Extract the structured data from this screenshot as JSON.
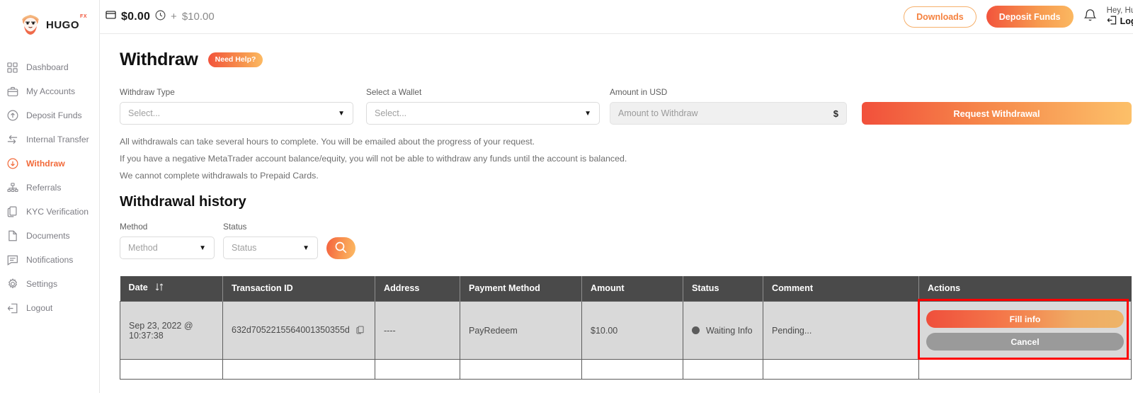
{
  "brand": {
    "name": "HUGO",
    "superscript": "FX"
  },
  "sidebar": {
    "items": [
      {
        "label": "Dashboard",
        "icon": "grid-icon",
        "active": false
      },
      {
        "label": "My Accounts",
        "icon": "briefcase-icon",
        "active": false
      },
      {
        "label": "Deposit Funds",
        "icon": "arrow-up-circle-icon",
        "active": false
      },
      {
        "label": "Internal Transfer",
        "icon": "transfer-icon",
        "active": false
      },
      {
        "label": "Withdraw",
        "icon": "arrow-down-circle-icon",
        "active": true
      },
      {
        "label": "Referrals",
        "icon": "sitemap-icon",
        "active": false
      },
      {
        "label": "KYC Verification",
        "icon": "copy-icon",
        "active": false
      },
      {
        "label": "Documents",
        "icon": "document-icon",
        "active": false
      },
      {
        "label": "Notifications",
        "icon": "message-icon",
        "active": false
      },
      {
        "label": "Settings",
        "icon": "gear-icon",
        "active": false
      },
      {
        "label": "Logout",
        "icon": "logout-icon",
        "active": false
      }
    ]
  },
  "topbar": {
    "balance": "$0.00",
    "plus": "+",
    "pending_balance": "$10.00",
    "downloads_label": "Downloads",
    "deposit_label": "Deposit Funds",
    "greeting": "Hey, Hugo's",
    "logout_label": "Logout"
  },
  "page": {
    "title": "Withdraw",
    "need_help_label": "Need Help?"
  },
  "form": {
    "withdraw_type": {
      "label": "Withdraw Type",
      "value": "Select..."
    },
    "wallet": {
      "label": "Select a Wallet",
      "value": "Select..."
    },
    "amount": {
      "label": "Amount in USD",
      "placeholder": "Amount to Withdraw",
      "value": "",
      "suffix": "$"
    },
    "submit_label": "Request Withdrawal"
  },
  "notes": [
    "All withdrawals can take several hours to complete. You will be emailed about the progress of your request.",
    "If you have a negative MetaTrader account balance/equity, you will not be able to withdraw any funds until the account is balanced.",
    "We cannot complete withdrawals to Prepaid Cards."
  ],
  "history": {
    "title": "Withdrawal history",
    "filters": {
      "method": {
        "label": "Method",
        "value": "Method"
      },
      "status": {
        "label": "Status",
        "value": "Status"
      },
      "search_icon": "search-icon"
    },
    "columns": [
      "Date",
      "Transaction ID",
      "Address",
      "Payment Method",
      "Amount",
      "Status",
      "Comment",
      "Actions"
    ],
    "sort_column": "Date",
    "rows": [
      {
        "date": "Sep 23, 2022 @ 10:37:38",
        "transaction_id": "632d7052215564001350355d",
        "address": "----",
        "payment_method": "PayRedeem",
        "amount": "$10.00",
        "status": "Waiting Info",
        "comment": "Pending...",
        "actions": {
          "primary": "Fill info",
          "secondary": "Cancel"
        }
      }
    ]
  },
  "colors": {
    "accent_start": "#f2543c",
    "accent_end": "#fcba63",
    "active_nav": "#f26a3a",
    "table_header_bg": "#4a4a4a",
    "row_bg": "#d9d9d9",
    "highlight": "#ff0000"
  }
}
